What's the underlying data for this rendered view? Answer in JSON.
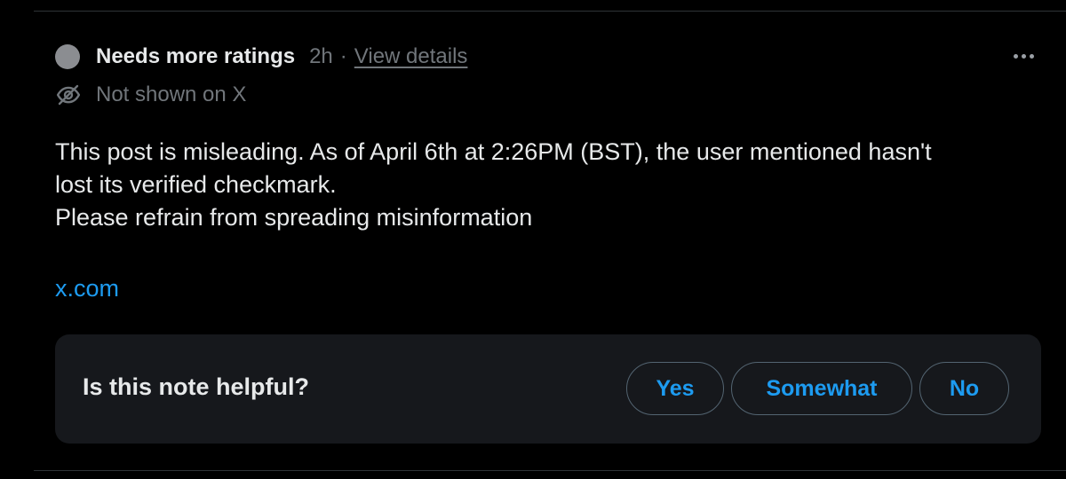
{
  "note": {
    "status_label": "Needs more ratings",
    "timestamp": "2h",
    "separator": "·",
    "details_link": "View details",
    "visibility": "Not shown on X",
    "body_lines": [
      "This post is misleading. As of April 6th at 2:26PM (BST), the user mentioned hasn't",
      "lost its verified checkmark.",
      "Please refrain from spreading misinformation"
    ],
    "link": "x.com"
  },
  "rating_prompt": {
    "question": "Is this note helpful?",
    "options": [
      "Yes",
      "Somewhat",
      "No"
    ]
  },
  "icons": {
    "status": "status-dot-icon",
    "visibility": "eye-off-icon",
    "more": "more-options-icon"
  },
  "colors": {
    "background": "#000000",
    "panel": "#16181c",
    "text": "#e7e9ea",
    "muted": "#71767b",
    "accent": "#1d9bf0",
    "status_dot": "#8b8d91"
  }
}
